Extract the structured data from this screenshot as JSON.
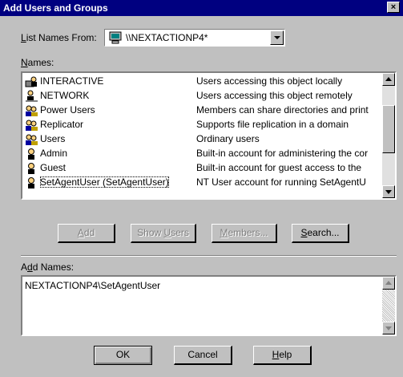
{
  "window": {
    "title": "Add Users and Groups",
    "close_glyph": "×"
  },
  "list_names_from": {
    "label_pre": "",
    "label_u": "L",
    "label_post": "ist Names From:",
    "value": "\\\\NEXTACTIONP4*",
    "icon": "computer-icon"
  },
  "names": {
    "label_u": "N",
    "label_post": "ames:",
    "rows": [
      {
        "name": "INTERACTIVE",
        "desc": "Users accessing this object locally",
        "icon": "interactive-group-icon"
      },
      {
        "name": "NETWORK",
        "desc": "Users accessing this object remotely",
        "icon": "network-group-icon"
      },
      {
        "name": "Power Users",
        "desc": "Members can share directories and print",
        "icon": "group-icon"
      },
      {
        "name": "Replicator",
        "desc": "Supports file replication in a domain",
        "icon": "group-icon"
      },
      {
        "name": "Users",
        "desc": "Ordinary users",
        "icon": "group-icon"
      },
      {
        "name": "Admin",
        "desc": "Built-in account for administering the cor",
        "icon": "user-icon"
      },
      {
        "name": "Guest",
        "desc": "Built-in account for guest access to the",
        "icon": "user-icon"
      },
      {
        "name": "SetAgentUser (SetAgentUser)",
        "desc": "NT User account for running SetAgentU",
        "icon": "user-icon"
      }
    ]
  },
  "buttons_row": {
    "add": {
      "pre": "",
      "u": "A",
      "post": "dd"
    },
    "show_users": {
      "pre": "Show ",
      "u": "U",
      "post": "sers"
    },
    "members": {
      "pre": "",
      "u": "M",
      "post": "embers..."
    },
    "search": {
      "pre": "",
      "u": "S",
      "post": "earch..."
    }
  },
  "add_names": {
    "label_pre": "A",
    "label_u": "d",
    "label_post": "d Names:",
    "value": "NEXTACTIONP4\\SetAgentUser"
  },
  "footer": {
    "ok": "OK",
    "cancel": "Cancel",
    "help": {
      "u": "H",
      "post": "elp"
    }
  }
}
